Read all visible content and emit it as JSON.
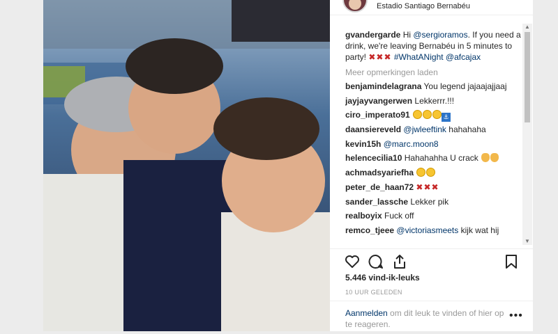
{
  "header": {
    "location": "Estadio Santiago Bernabéu"
  },
  "caption": {
    "username": "gvandergarde",
    "text_before": "Hi ",
    "mention1": "@sergioramos",
    "text_middle": ". If you need a drink, we're leaving Bernabéu in 5 minutes to party! ",
    "crosses": "✖✖✖",
    "hashtag": "#WhatANight",
    "mention2": "@afcajax"
  },
  "load_more": "Meer opmerkingen laden",
  "comments": [
    {
      "username": "benjamindelagrana",
      "text": "You legend jajaajajjaaj"
    },
    {
      "username": "jayjayvangerwen",
      "text": "Lekkerrr.!!!"
    },
    {
      "username": "ciro_imperato91",
      "text": "",
      "emoji": "laughing-emoji"
    },
    {
      "username": "daansiereveld",
      "mention": "@jwleeftink",
      "text": "hahahaha"
    },
    {
      "username": "kevin15h",
      "mention": "@marc.moon8",
      "text": ""
    },
    {
      "username": "helencecilia10",
      "text": "Hahahahha U crack",
      "emoji": "clapping-emoji"
    },
    {
      "username": "achmadsyariefha",
      "text": "",
      "emoji": "laughing-emoji"
    },
    {
      "username": "peter_de_haan72",
      "text": "",
      "crosses": "✖✖✖"
    },
    {
      "username": "sander_lassche",
      "text": "Lekker pik"
    },
    {
      "username": "realboyix",
      "text": "Fuck off"
    },
    {
      "username": "remco_tjeee",
      "mention": "@victoriasmeets",
      "text": "kijk wat hij"
    }
  ],
  "actions": {
    "like": "heart-icon",
    "comment": "comment-icon",
    "share": "share-icon",
    "save": "bookmark-icon"
  },
  "likes": "5.446 vind-ik-leuks",
  "timestamp": "10 UUR GELEDEN",
  "footer": {
    "login": "Aanmelden",
    "text": " om dit leuk te vinden of hier op te reageren."
  },
  "colors": {
    "link": "#003569",
    "muted": "#999999",
    "text": "#262626",
    "cross": "#c62828"
  }
}
